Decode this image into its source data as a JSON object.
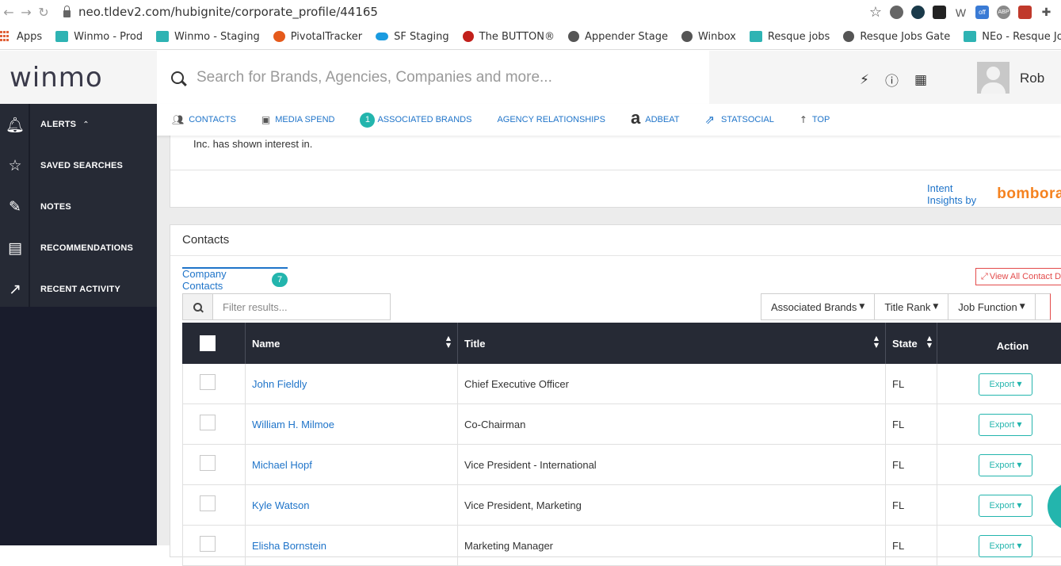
{
  "browser": {
    "url": "neo.tldev2.com/hubignite/corporate_profile/44165",
    "bookmarks": [
      "Apps",
      "Winmo - Prod",
      "Winmo - Staging",
      "PivotalTracker",
      "SF Staging",
      "The BUTTON®",
      "Appender Stage",
      "Winbox",
      "Resque jobs",
      "Resque Jobs Gate",
      "NEo - Resque Jobs"
    ],
    "ext_badge": "off",
    "ext_abp": "ABP"
  },
  "header": {
    "logo": "winmo",
    "search_placeholder": "Search for Brands, Agencies, Companies and more...",
    "user_name": "Rob"
  },
  "sidebar": {
    "items": [
      {
        "label": "ALERTS",
        "icon": "bell-icon"
      },
      {
        "label": "SAVED SEARCHES",
        "icon": "star-icon"
      },
      {
        "label": "NOTES",
        "icon": "pencil-icon"
      },
      {
        "label": "RECOMMENDATIONS",
        "icon": "document-icon"
      },
      {
        "label": "RECENT ACTIVITY",
        "icon": "trend-icon"
      }
    ]
  },
  "profile_nav": {
    "contacts": "CONTACTS",
    "media_spend": "MEDIA SPEND",
    "associated_brands_count": "1",
    "associated_brands": "ASSOCIATED BRANDS",
    "agency_relationships": "AGENCY RELATIONSHIPS",
    "adbeat": "ADBEAT",
    "statsocial": "STATSOCIAL",
    "top": "TOP"
  },
  "intent": {
    "text": "Inc. has shown interest in.",
    "insights_label": "Intent Insights by",
    "brand": "bombora"
  },
  "contacts": {
    "title": "Contacts",
    "tab_label": "Company Contacts",
    "tab_count": "7",
    "view_all": "View All Contact D",
    "filter_placeholder": "Filter results...",
    "dropdowns": [
      "Associated Brands",
      "Title Rank",
      "Job Function"
    ],
    "columns": {
      "name": "Name",
      "title": "Title",
      "state": "State",
      "action": "Action"
    },
    "export_label": "Export",
    "rows": [
      {
        "name": "John Fieldly",
        "title": "Chief Executive Officer",
        "state": "FL"
      },
      {
        "name": "William H. Milmoe",
        "title": "Co-Chairman",
        "state": "FL"
      },
      {
        "name": "Michael Hopf",
        "title": "Vice President - International",
        "state": "FL"
      },
      {
        "name": "Kyle Watson",
        "title": "Vice President, Marketing",
        "state": "FL"
      },
      {
        "name": "Elisha Bornstein",
        "title": "Marketing Manager",
        "state": "FL"
      }
    ]
  },
  "colors": {
    "accent": "#23b5ad",
    "link": "#1f74c9",
    "dark": "#262a35",
    "danger": "#e34b4b",
    "bombora": "#f5821f"
  }
}
